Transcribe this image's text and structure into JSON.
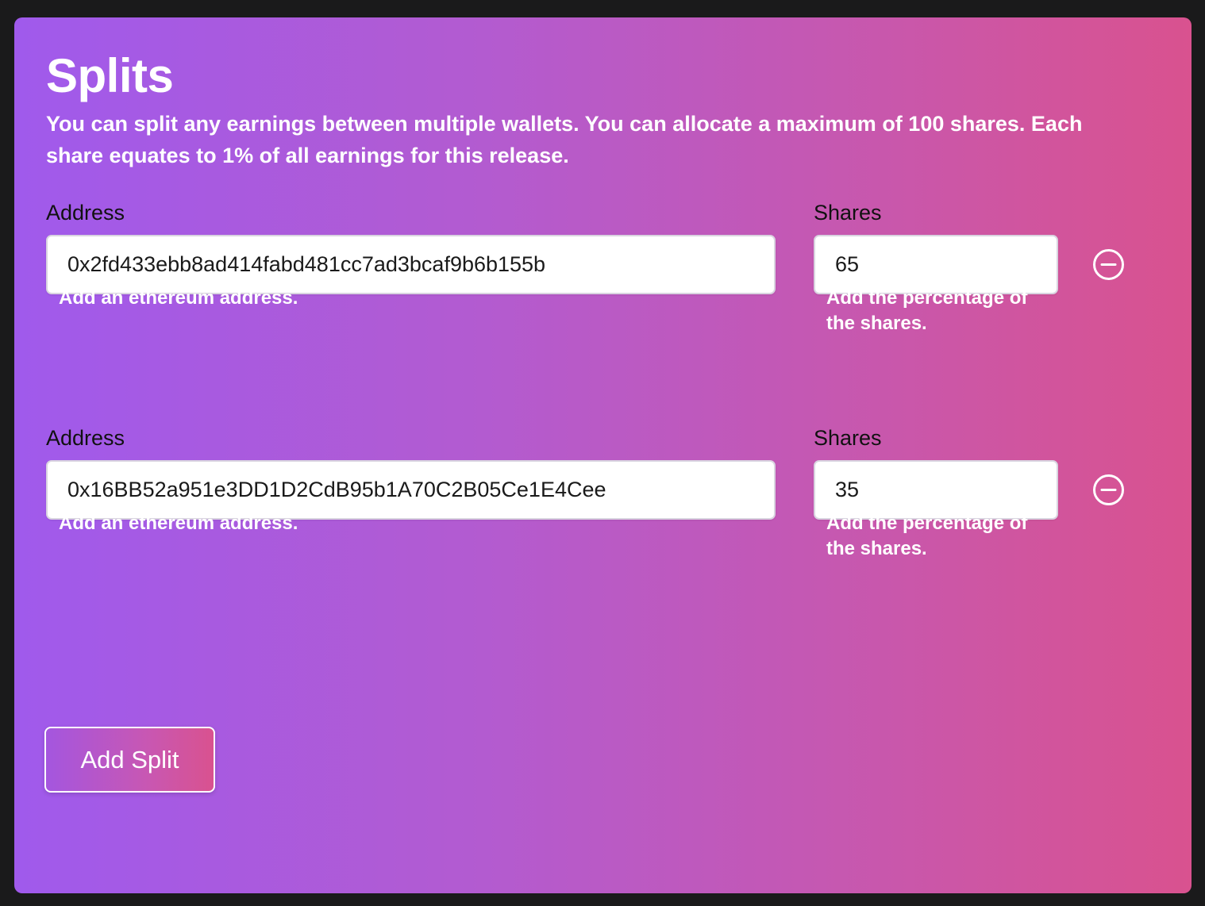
{
  "page": {
    "title": "Splits",
    "description": "You can split any earnings between multiple wallets. You can allocate a maximum of 100 shares. Each share equates to 1% of all earnings for this release."
  },
  "splits": [
    {
      "address_label": "Address",
      "address_value": "0x2fd433ebb8ad414fabd481cc7ad3bcaf9b6b155b",
      "address_help": "Add an ethereum address.",
      "shares_label": "Shares",
      "shares_value": "65",
      "shares_help": "Add the percentage of the shares.",
      "remove_icon": "minus-circle-icon"
    },
    {
      "address_label": "Address",
      "address_value": "0x16BB52a951e3DD1D2CdB95b1A70C2B05Ce1E4Cee",
      "address_help": "Add an ethereum address.",
      "shares_label": "Shares",
      "shares_value": "35",
      "shares_help": "Add the percentage of the shares.",
      "remove_icon": "minus-circle-icon"
    }
  ],
  "actions": {
    "add_split_label": "Add Split"
  },
  "colors": {
    "gradient_start": "#a05aec",
    "gradient_end": "#d9528f",
    "page_background": "#1a1a1b"
  }
}
